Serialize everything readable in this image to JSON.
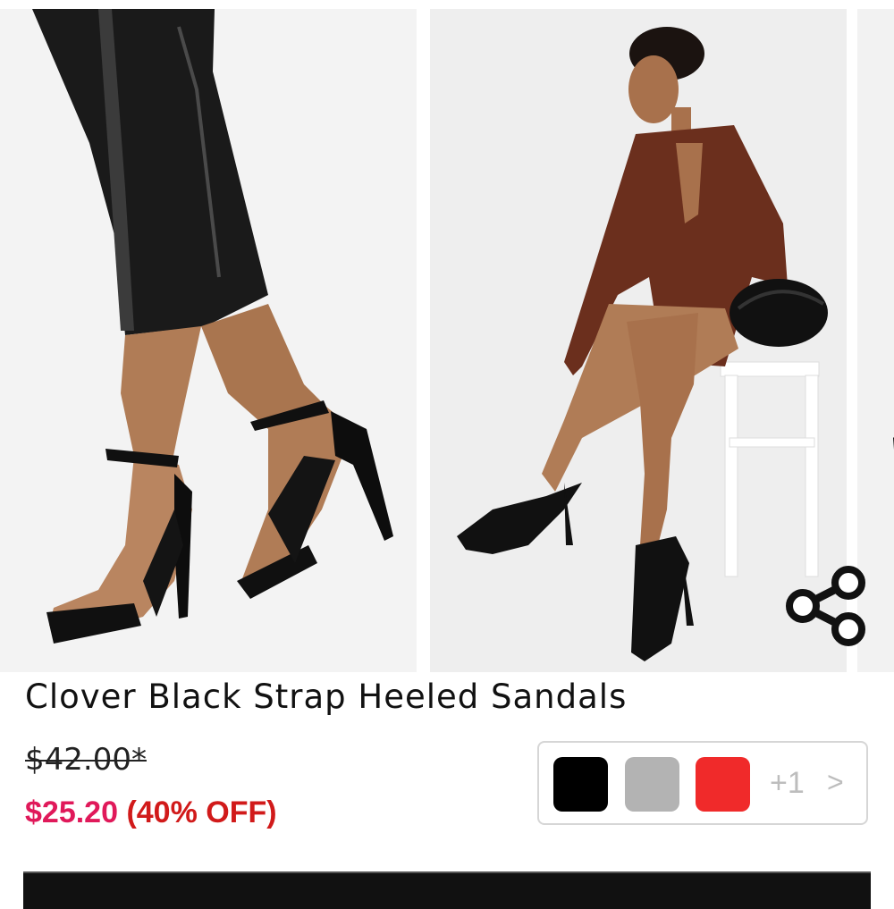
{
  "product": {
    "title": "Clover Black Strap Heeled Sandals",
    "original_price": "$42.00*",
    "sale_price": "$25.20",
    "discount": "(40% OFF)"
  },
  "colors": {
    "swatches": [
      {
        "name": "black",
        "hex": "#000000"
      },
      {
        "name": "grey",
        "hex": "#b3b3b3"
      },
      {
        "name": "red",
        "hex": "#f02a2a"
      }
    ],
    "more_label": "+1",
    "more_arrow": ">",
    "sale_color": "#e0195a"
  },
  "icons": {
    "share": "share-icon"
  }
}
